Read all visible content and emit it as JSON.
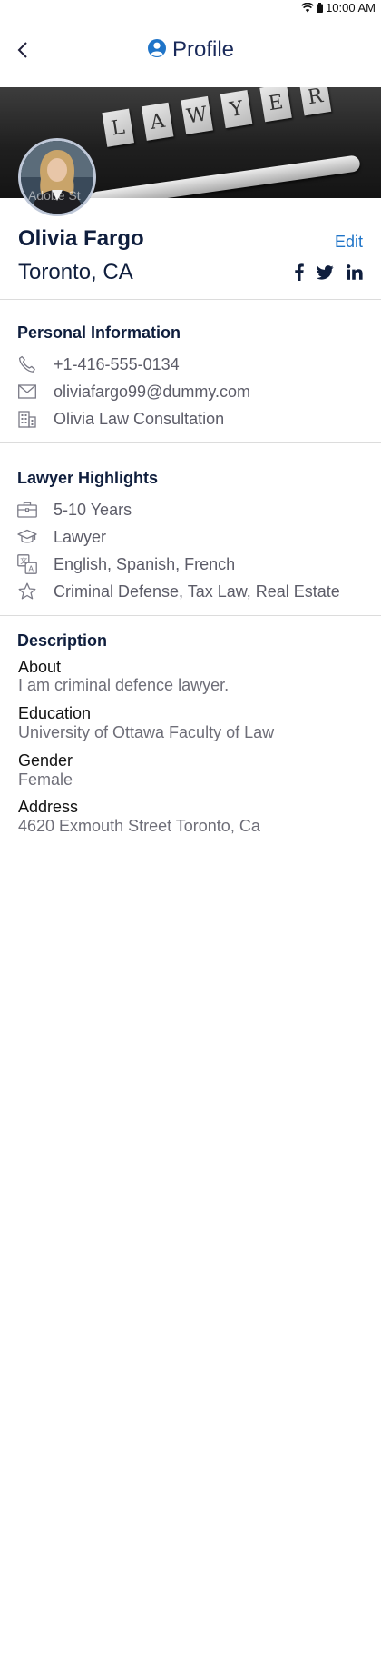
{
  "status_bar": {
    "time": "10:00 AM"
  },
  "header": {
    "title": "Profile"
  },
  "cover": {
    "tiles": [
      "L",
      "A",
      "W",
      "Y",
      "E",
      "R"
    ],
    "watermark": "Adobe St"
  },
  "profile": {
    "name": "Olivia Fargo",
    "location": "Toronto, CA",
    "edit_label": "Edit"
  },
  "personal_info": {
    "title": "Personal Information",
    "phone": "+1-416-555-0134",
    "email": "oliviafargo99@dummy.com",
    "company": "Olivia Law Consultation"
  },
  "highlights": {
    "title": "Lawyer Highlights",
    "experience": "5-10 Years",
    "profession": "Lawyer",
    "languages": "English, Spanish, French",
    "specialties": "Criminal Defense, Tax Law, Real Estate"
  },
  "description": {
    "title": "Description",
    "items": [
      {
        "label": "About",
        "value": "I am criminal defence lawyer."
      },
      {
        "label": "Education",
        "value": "University of Ottawa Faculty of Law"
      },
      {
        "label": "Gender",
        "value": "Female"
      },
      {
        "label": "Address",
        "value": "4620  Exmouth Street Toronto, Ca"
      }
    ]
  },
  "colors": {
    "accent": "#1f74c8",
    "text_dark": "#0f1e3d",
    "text_muted": "#5c5c68",
    "divider": "#dcdcdc"
  }
}
